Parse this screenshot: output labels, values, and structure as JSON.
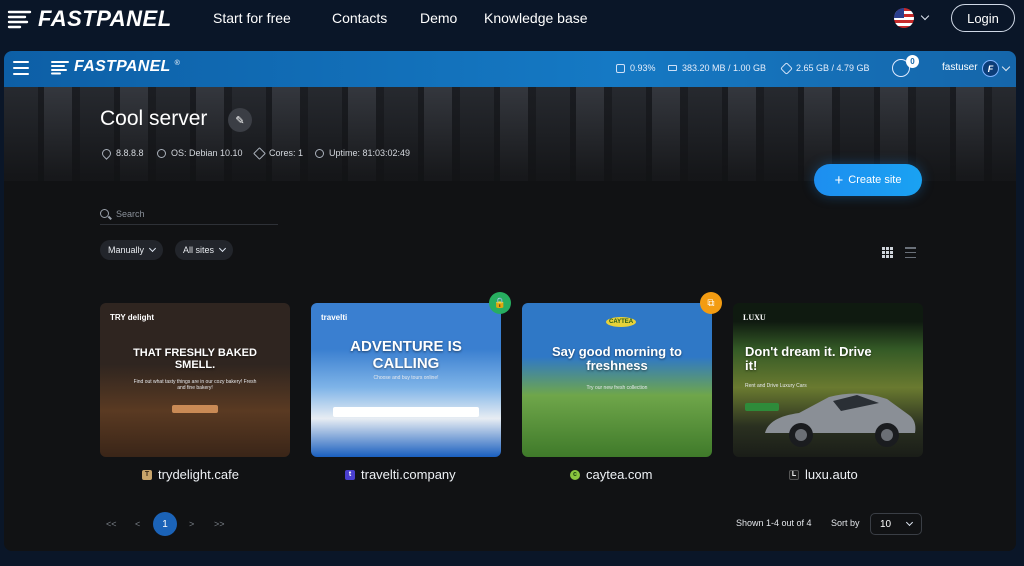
{
  "site": {
    "brand": "FASTPANEL",
    "nav": [
      "Start for free",
      "Contacts",
      "Demo",
      "Knowledge base"
    ],
    "login_label": "Login",
    "language_icon": "us-flag-icon"
  },
  "panel": {
    "brand": "FASTPANEL",
    "brand_mark": "®",
    "stats": {
      "cpu": "0.93%",
      "memory": "383.20 MB / 1.00 GB",
      "disk": "2.65 GB / 4.79 GB"
    },
    "notifications": "0",
    "username": "fastuser",
    "avatar_initial": "F"
  },
  "server": {
    "name": "Cool server",
    "ip": "8.8.8.8",
    "os": "OS: Debian 10.10",
    "cores": "Cores: 1",
    "uptime": "Uptime: 81:03:02:49"
  },
  "actions": {
    "create_site": "Create site",
    "create_icon": "+"
  },
  "search": {
    "placeholder": "Search"
  },
  "filters": {
    "sort_mode": "Manually",
    "scope": "All sites"
  },
  "sites": [
    {
      "domain": "trydelight.cafe",
      "favicon": "T",
      "favicon_color": "#c9a56b",
      "head": "TRY delight",
      "title": "THAT FRESHLY BAKED SMELL.",
      "subtitle": "Find out what tasty things are in our cozy bakery! Fresh and fine bakery!"
    },
    {
      "domain": "travelti.company",
      "favicon": "t",
      "favicon_color": "#4a3fcf",
      "head": "travelti",
      "title": "ADVENTURE IS CALLING",
      "subtitle": "Choose and buy tours online!",
      "badge": "lock-icon",
      "badge_color": "#27ae60"
    },
    {
      "domain": "caytea.com",
      "favicon": "c",
      "favicon_color": "#8bc53f",
      "head": "CAYTEA",
      "title": "Say good morning to freshness",
      "subtitle": "Try our new fresh collection",
      "badge": "copy-icon",
      "badge_color": "#f39c12"
    },
    {
      "domain": "luxu.auto",
      "favicon": "L",
      "favicon_color": "#1c1c1c",
      "head": "LUXU",
      "title": "Don't dream it. Drive it!",
      "subtitle": "Rent and Drive Luxury Cars"
    }
  ],
  "pagination": {
    "first": "<<",
    "prev": "<",
    "current": "1",
    "next": ">",
    "last": ">>",
    "shown": "Shown 1-4 out of 4",
    "sort_by_label": "Sort by",
    "per_page": "10"
  }
}
